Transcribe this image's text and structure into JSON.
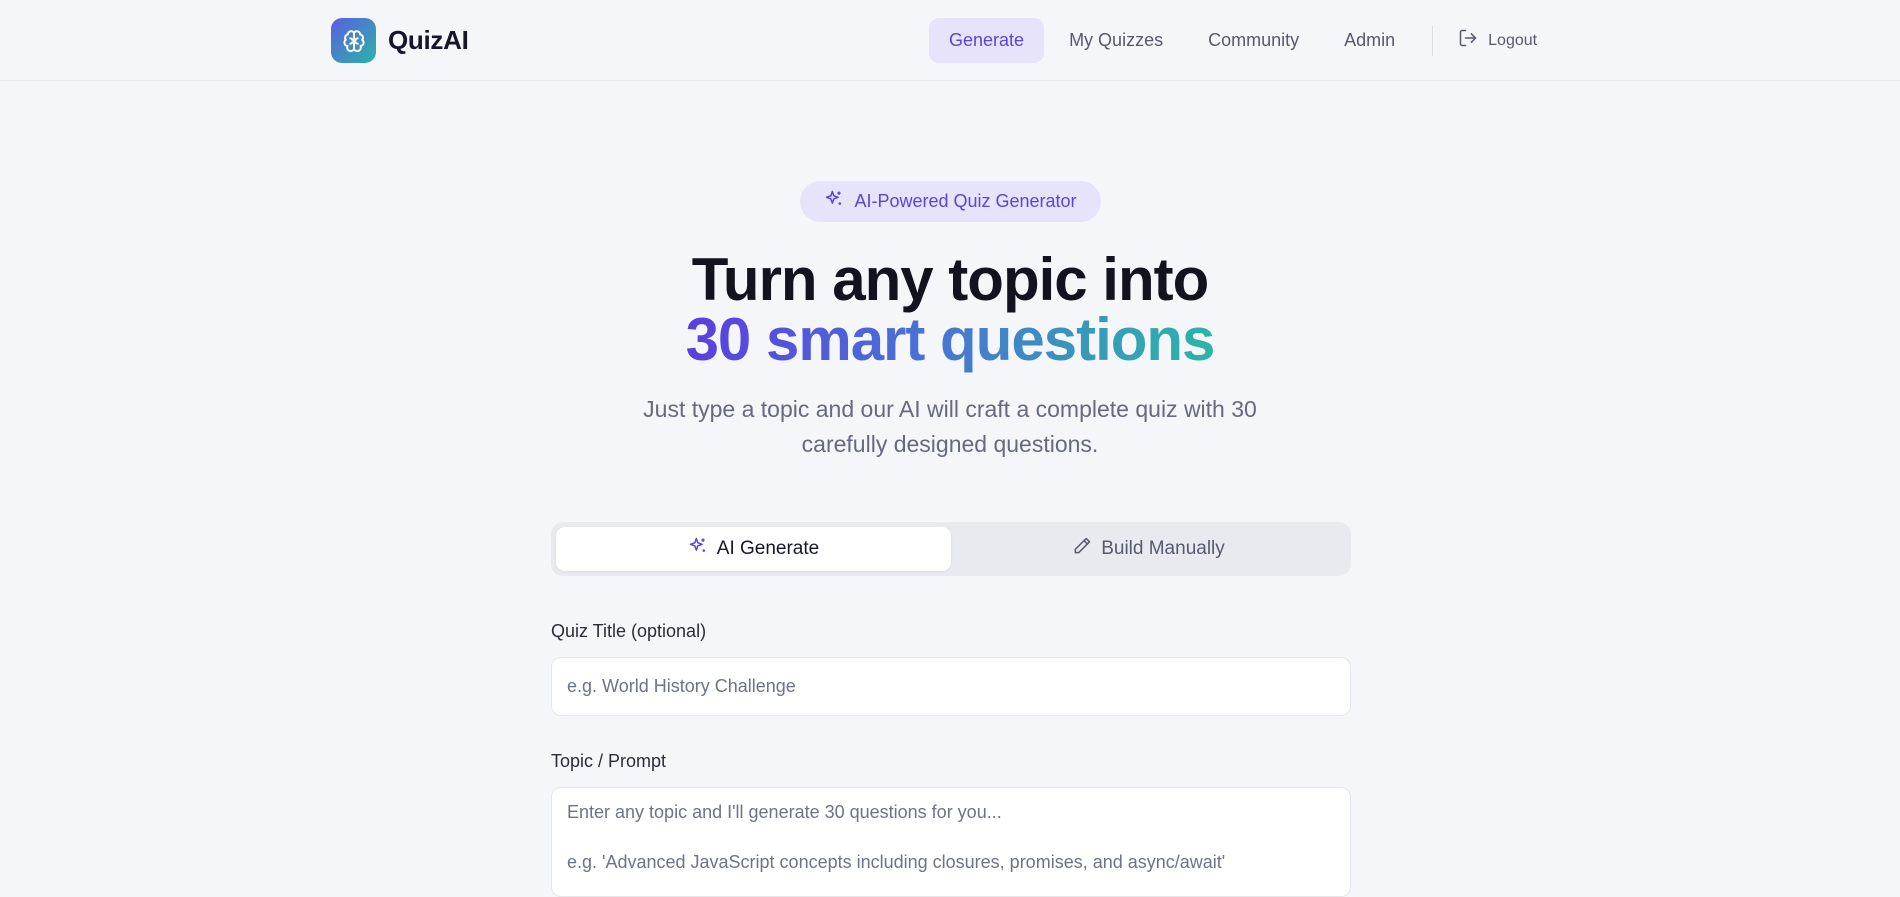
{
  "brand": {
    "name": "QuizAI",
    "logo_icon": "brain-icon"
  },
  "nav": {
    "items": [
      {
        "label": "Generate",
        "active": true
      },
      {
        "label": "My Quizzes",
        "active": false
      },
      {
        "label": "Community",
        "active": false
      },
      {
        "label": "Admin",
        "active": false
      }
    ],
    "logout_label": "Logout"
  },
  "hero": {
    "badge": "AI-Powered Quiz Generator",
    "title_line1": "Turn any topic into",
    "title_line2": "30 smart questions",
    "subtitle": "Just type a topic and our AI will craft a complete quiz with 30 carefully designed questions."
  },
  "mode_tabs": [
    {
      "label": "AI Generate",
      "icon": "sparkles-icon",
      "active": true
    },
    {
      "label": "Build Manually",
      "icon": "pencil-icon",
      "active": false
    }
  ],
  "form": {
    "title_label": "Quiz Title (optional)",
    "title_placeholder": "e.g. World History Challenge",
    "title_value": "",
    "topic_label": "Topic / Prompt",
    "topic_placeholder": "Enter any topic and I'll generate 30 questions for you...\n\ne.g. 'Advanced JavaScript concepts including closures, promises, and async/await'",
    "topic_value": ""
  },
  "colors": {
    "accent": "#5b45d6",
    "accent_bg": "#e6e3fb",
    "gradient_start": "#5b3ee0",
    "gradient_end": "#2bb5a6",
    "page_bg": "#f5f6fa"
  }
}
